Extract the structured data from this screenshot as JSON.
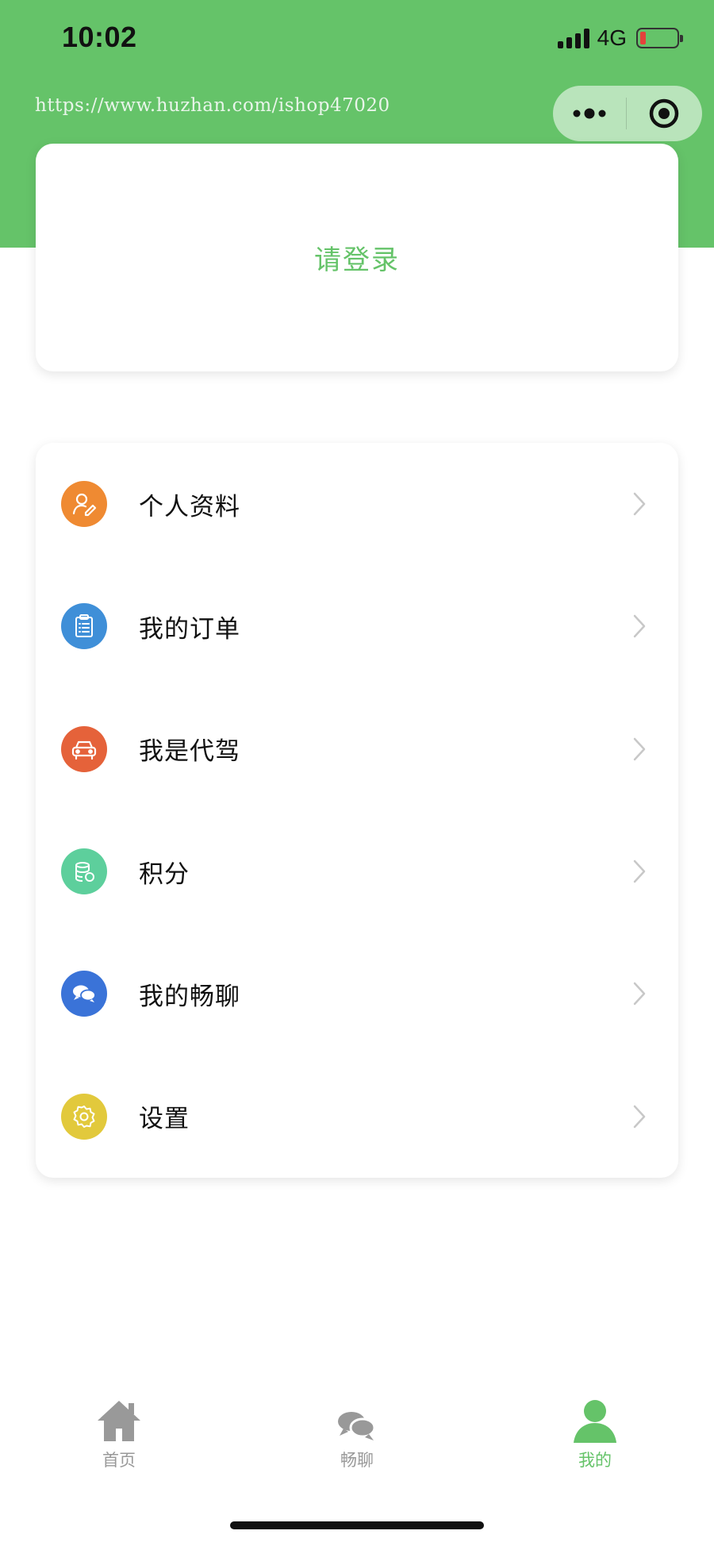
{
  "status_bar": {
    "time": "10:02",
    "network": "4G"
  },
  "watermark": {
    "url": "https://www.huzhan.com/ishop47020"
  },
  "capsule": {
    "more_icon": "more-dots-icon",
    "close_icon": "target-circle-icon"
  },
  "login_card": {
    "prompt": "请登录"
  },
  "menu": {
    "items": [
      {
        "label": "个人资料",
        "icon": "user-edit-icon",
        "color": "#ef8a32"
      },
      {
        "label": "我的订单",
        "icon": "clipboard-list-icon",
        "color": "#3f8fd8"
      },
      {
        "label": "我是代驾",
        "icon": "car-icon",
        "color": "#e5623a"
      },
      {
        "label": "积分",
        "icon": "coin-stack-icon",
        "color": "#5dcf9c"
      },
      {
        "label": "我的畅聊",
        "icon": "chat-bubbles-icon",
        "color": "#3a73d8"
      },
      {
        "label": "设置",
        "icon": "gear-icon",
        "color": "#e2c93c"
      }
    ]
  },
  "tabbar": {
    "tabs": [
      {
        "label": "首页",
        "icon": "home-icon",
        "active": false
      },
      {
        "label": "畅聊",
        "icon": "chat-icon",
        "active": false
      },
      {
        "label": "我的",
        "icon": "user-icon",
        "active": true
      }
    ]
  },
  "colors": {
    "brand_green": "#65c369",
    "inactive_tab": "#999999"
  }
}
